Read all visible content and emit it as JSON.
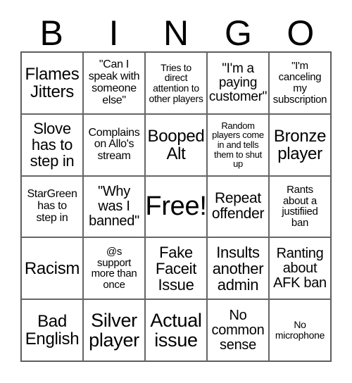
{
  "header": [
    "B",
    "I",
    "N",
    "G",
    "O"
  ],
  "cells": [
    "Flames\nJitters",
    "\"Can I\nspeak with\nsomeone\nelse\"",
    "Tries to\ndirect\nattention to\nother players",
    "\"I'm a\npaying\ncustomer\"",
    "\"I'm\ncanceling\nmy\nsubscription",
    "Slove\nhas to\nstep in",
    "Complains\non Allo's\nstream",
    "Booped\nAlt",
    "Random\nplayers come\nin and tells\nthem to shut\nup",
    "Bronze\nplayer",
    "StarGreen\nhas to\nstep in",
    "\"Why\nwas I\nbanned\"",
    "Free!",
    "Repeat\noffender",
    "Rants\nabout a\njustifiied\nban",
    "Racism",
    "@s\nsupport\nmore than\nonce",
    "Fake\nFaceit\nIssue",
    "Insults\nanother\nadmin",
    "Ranting\nabout\nAFK ban",
    "Bad\nEnglish",
    "Silver\nplayer",
    "Actual\nissue",
    "No\ncommon\nsense",
    "No\nmicrophone"
  ]
}
